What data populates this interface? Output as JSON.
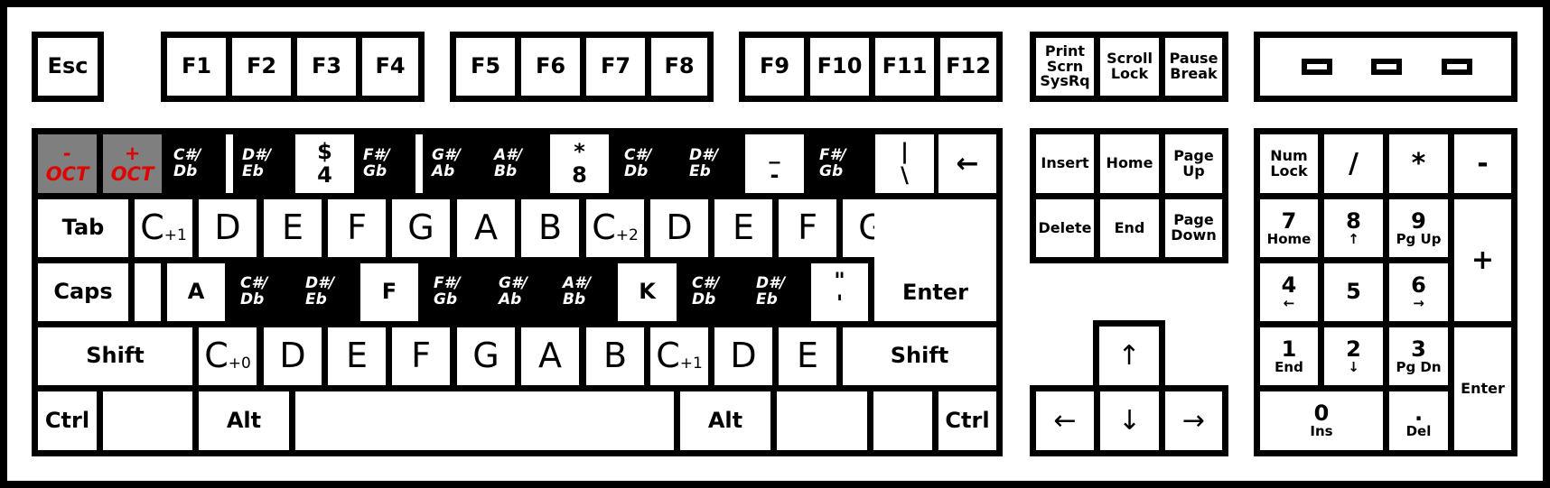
{
  "function_row": {
    "esc": "Esc",
    "f1": "F1",
    "f2": "F2",
    "f3": "F3",
    "f4": "F4",
    "f5": "F5",
    "f6": "F6",
    "f7": "F7",
    "f8": "F8",
    "f9": "F9",
    "f10": "F10",
    "f11": "F11",
    "f12": "F12",
    "print_screen": "Print\nScrn\nSysRq",
    "scroll_lock": "Scroll\nLock",
    "pause_break": "Pause\nBreak"
  },
  "number_row": [
    {
      "top": "-",
      "bottom": "OCT",
      "kind": "oct"
    },
    {
      "top": "+",
      "bottom": "OCT",
      "kind": "oct"
    },
    {
      "top": "C#/",
      "bottom": "Db",
      "kind": "black"
    },
    {
      "top": "",
      "bottom": "",
      "kind": "white"
    },
    {
      "top": "D#/",
      "bottom": "Eb",
      "kind": "black"
    },
    {
      "top": "$",
      "bottom": "4",
      "kind": "white"
    },
    {
      "top": "F#/",
      "bottom": "Gb",
      "kind": "black"
    },
    {
      "top": "",
      "bottom": "",
      "kind": "white"
    },
    {
      "top": "G#/",
      "bottom": "Ab",
      "kind": "black"
    },
    {
      "top": "A#/",
      "bottom": "Bb",
      "kind": "black"
    },
    {
      "top": "*",
      "bottom": "8",
      "kind": "white"
    },
    {
      "top": "C#/",
      "bottom": "Db",
      "kind": "black"
    },
    {
      "top": "D#/",
      "bottom": "Eb",
      "kind": "black"
    },
    {
      "top": "_",
      "bottom": "-",
      "kind": "white"
    },
    {
      "top": "F#/",
      "bottom": "Gb",
      "kind": "black"
    },
    {
      "top": "|",
      "bottom": "\\",
      "kind": "white"
    },
    {
      "top": "←",
      "bottom": "",
      "kind": "white"
    }
  ],
  "tab_row": {
    "tab": "Tab",
    "notes": [
      {
        "letter": "C",
        "sub": "+1"
      },
      {
        "letter": "D",
        "sub": ""
      },
      {
        "letter": "E",
        "sub": ""
      },
      {
        "letter": "F",
        "sub": ""
      },
      {
        "letter": "G",
        "sub": ""
      },
      {
        "letter": "A",
        "sub": ""
      },
      {
        "letter": "B",
        "sub": ""
      },
      {
        "letter": "C",
        "sub": "+2"
      },
      {
        "letter": "D",
        "sub": ""
      },
      {
        "letter": "E",
        "sub": ""
      },
      {
        "letter": "F",
        "sub": ""
      },
      {
        "letter": "G",
        "sub": ""
      }
    ]
  },
  "caps_row": {
    "caps": "Caps",
    "keys": [
      {
        "top": "",
        "bottom": "",
        "kind": "white"
      },
      {
        "top": "A",
        "bottom": "",
        "kind": "white"
      },
      {
        "top": "C#/",
        "bottom": "Db",
        "kind": "black"
      },
      {
        "top": "D#/",
        "bottom": "Eb",
        "kind": "black"
      },
      {
        "top": "F",
        "bottom": "",
        "kind": "white"
      },
      {
        "top": "F#/",
        "bottom": "Gb",
        "kind": "black"
      },
      {
        "top": "G#/",
        "bottom": "Ab",
        "kind": "black"
      },
      {
        "top": "A#/",
        "bottom": "Bb",
        "kind": "black"
      },
      {
        "top": "K",
        "bottom": "",
        "kind": "white"
      },
      {
        "top": "C#/",
        "bottom": "Db",
        "kind": "black"
      },
      {
        "top": "D#/",
        "bottom": "Eb",
        "kind": "black"
      },
      {
        "top": "\"",
        "bottom": "'",
        "kind": "white"
      }
    ],
    "enter": "Enter"
  },
  "shift_row": {
    "left_shift": "Shift",
    "notes": [
      {
        "letter": "C",
        "sub": "+0"
      },
      {
        "letter": "D",
        "sub": ""
      },
      {
        "letter": "E",
        "sub": ""
      },
      {
        "letter": "F",
        "sub": ""
      },
      {
        "letter": "G",
        "sub": ""
      },
      {
        "letter": "A",
        "sub": ""
      },
      {
        "letter": "B",
        "sub": ""
      },
      {
        "letter": "C",
        "sub": "+1"
      },
      {
        "letter": "D",
        "sub": ""
      },
      {
        "letter": "E",
        "sub": ""
      }
    ],
    "right_shift": "Shift"
  },
  "bottom_row": {
    "left_ctrl": "Ctrl",
    "left_alt": "Alt",
    "right_alt": "Alt",
    "right_ctrl": "Ctrl"
  },
  "nav_cluster": {
    "insert": "Insert",
    "home": "Home",
    "page_up": "Page\nUp",
    "delete": "Delete",
    "end": "End",
    "page_down": "Page\nDown",
    "up": "↑",
    "left": "←",
    "down": "↓",
    "right": "→"
  },
  "numpad": {
    "num_lock": "Num\nLock",
    "divide": "/",
    "multiply": "*",
    "minus": "-",
    "plus": "+",
    "enter": "Enter",
    "k7": {
      "main": "7",
      "sub": "Home"
    },
    "k8": {
      "main": "8",
      "sub": "↑"
    },
    "k9": {
      "main": "9",
      "sub": "Pg Up"
    },
    "k4": {
      "main": "4",
      "sub": "←"
    },
    "k5": {
      "main": "5",
      "sub": ""
    },
    "k6": {
      "main": "6",
      "sub": "→"
    },
    "k1": {
      "main": "1",
      "sub": "End"
    },
    "k2": {
      "main": "2",
      "sub": "↓"
    },
    "k3": {
      "main": "3",
      "sub": "Pg Dn"
    },
    "k0": {
      "main": "0",
      "sub": "Ins"
    },
    "dot": {
      "main": ".",
      "sub": "Del"
    }
  },
  "colors": {
    "frame": "#000000",
    "white_key": "#ffffff",
    "black_key": "#000000",
    "octave_key": "#7f7f7f",
    "octave_text": "#e00000"
  }
}
